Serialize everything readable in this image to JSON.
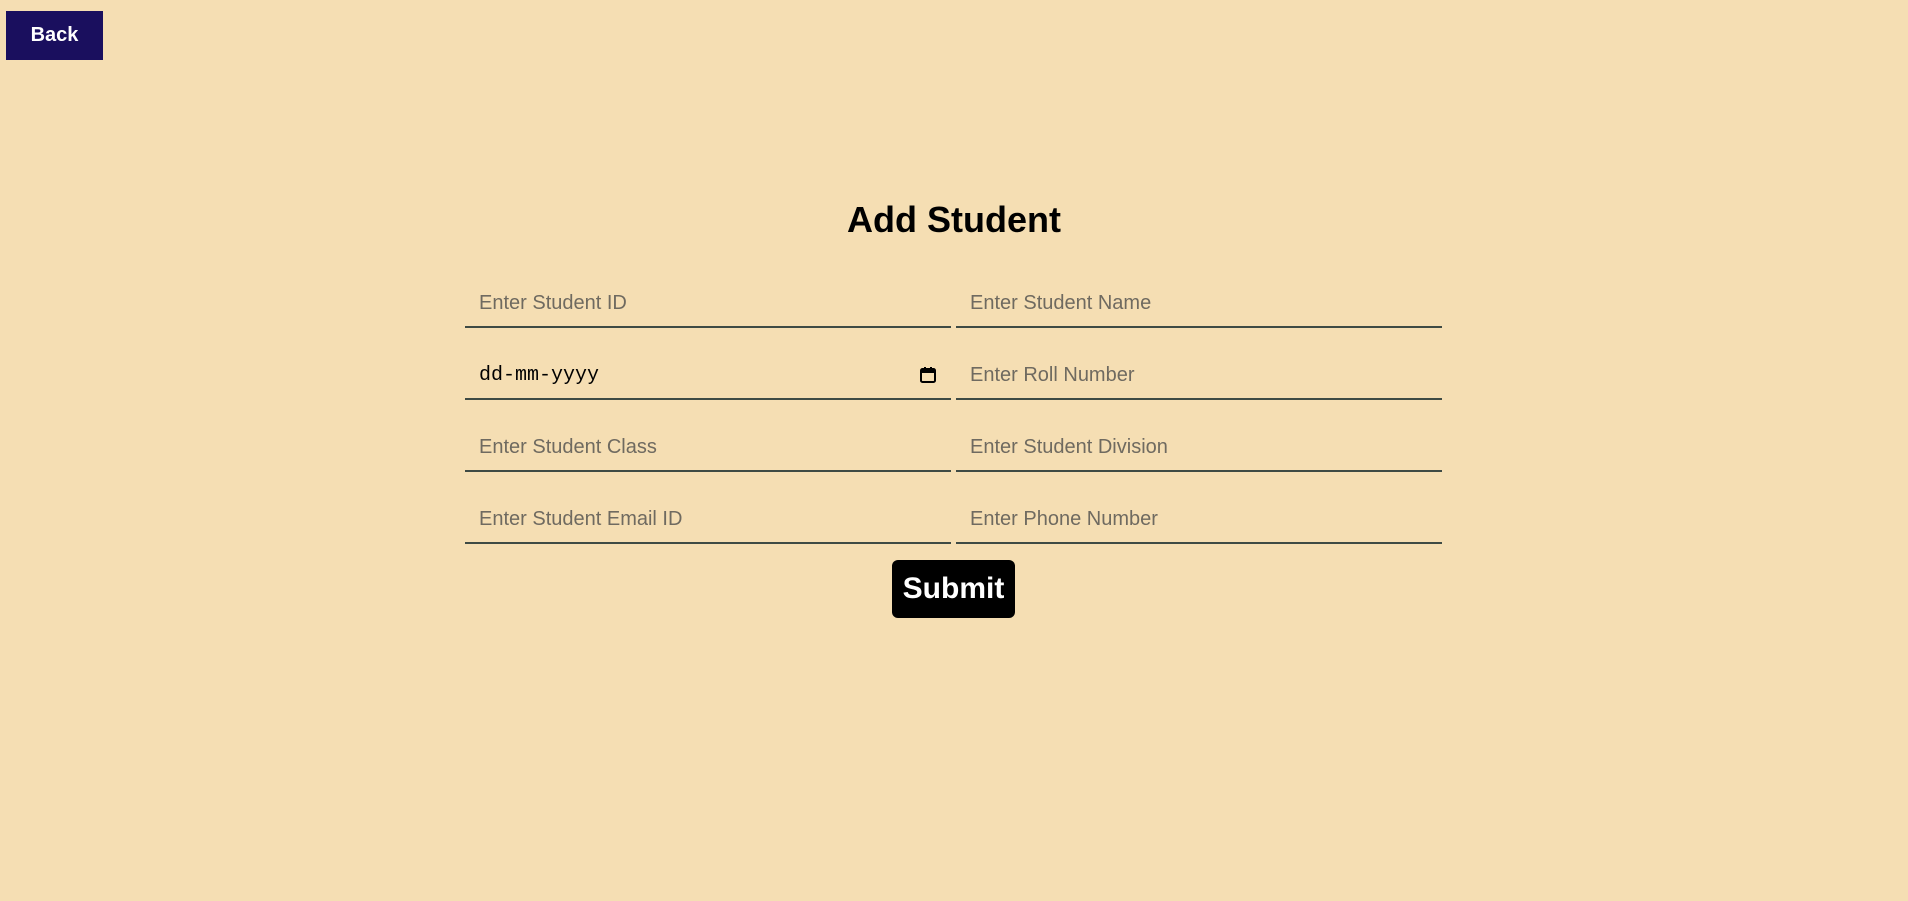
{
  "nav": {
    "back_label": "Back"
  },
  "form": {
    "title": "Add Student",
    "fields": {
      "student_id": {
        "placeholder": "Enter Student ID",
        "value": ""
      },
      "student_name": {
        "placeholder": "Enter Student Name",
        "value": ""
      },
      "date_of_birth": {
        "display": "dd-mm-yyyy",
        "value": ""
      },
      "roll_number": {
        "placeholder": "Enter Roll Number",
        "value": ""
      },
      "student_class": {
        "placeholder": "Enter Student Class",
        "value": ""
      },
      "student_division": {
        "placeholder": "Enter Student Division",
        "value": ""
      },
      "email": {
        "placeholder": "Enter Student Email ID",
        "value": ""
      },
      "phone": {
        "placeholder": "Enter Phone Number",
        "value": ""
      }
    },
    "submit_label": "Submit"
  },
  "icons": {
    "date_picker": "calendar-icon"
  },
  "colors": {
    "background": "#f5deb3",
    "back_button": "#1a0f5e",
    "submit_button": "#000000",
    "field_underline": "#3e4a44"
  }
}
